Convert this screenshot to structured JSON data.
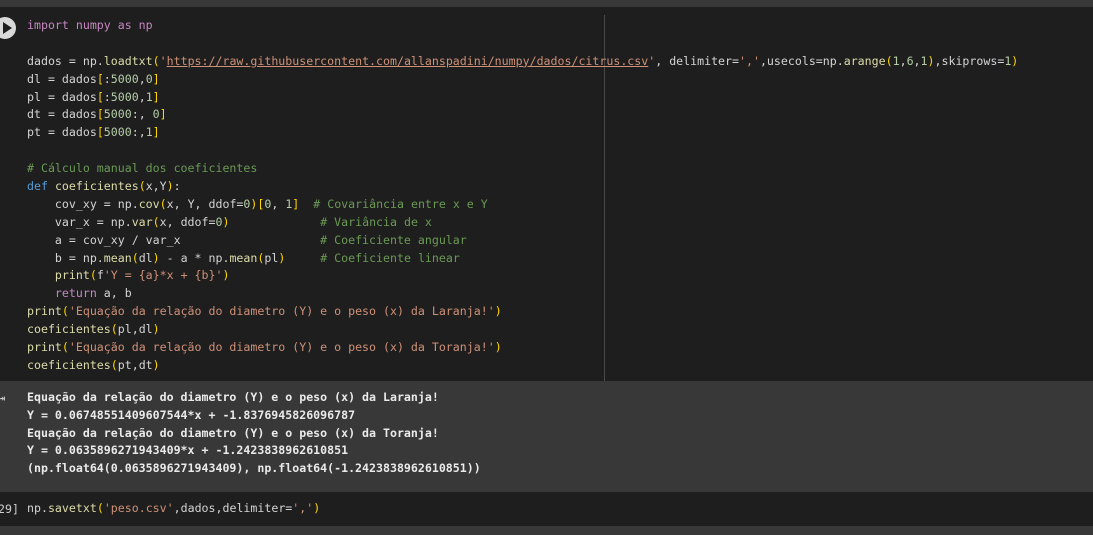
{
  "cell1": {
    "lines": [
      "import numpy as np",
      "",
      "dados = np.loadtxt('https://raw.githubusercontent.com/allanspadini/numpy/dados/citrus.csv', delimiter=',',usecols=np.arange(1,6,1),skiprows=1)",
      "dl = dados[:5000,0]",
      "pl = dados[:5000,1]",
      "dt = dados[5000:, 0]",
      "pt = dados[5000:,1]",
      "",
      "# Cálculo manual dos coeficientes",
      "def coeficientes(x,Y):",
      "    cov_xy = np.cov(x, Y, ddof=0)[0, 1]  # Covariância entre x e Y",
      "    var_x = np.var(x, ddof=0)             # Variância de x",
      "    a = cov_xy / var_x                    # Coeficiente angular",
      "    b = np.mean(dl) - a * np.mean(pl)     # Coeficiente linear",
      "    print(f'Y = {a}*x + {b}')",
      "    return a, b",
      "print('Equação da relação do diametro (Y) e o peso (x) da Laranja!')",
      "coeficientes(pl,dl)",
      "print('Equação da relação do diametro (Y) e o peso (x) da Toranja!')",
      "coeficientes(pt,dt)"
    ]
  },
  "output": {
    "lines": [
      "Equação da relação do diametro (Y) e o peso (x) da Laranja!",
      "Y = 0.06748551409607544*x + -1.8376945826096787",
      "Equação da relação do diametro (Y) e o peso (x) da Toranja!",
      "Y = 0.0635896271943409*x + -1.2423838962610851",
      "(np.float64(0.0635896271943409), np.float64(-1.2423838962610851))"
    ]
  },
  "cell2": {
    "exec_count": "29]",
    "code": "np.savetxt('peso.csv',dados,delimiter=',')"
  },
  "icons": {
    "run": "run-cell-icon",
    "output": "output-toggle-icon"
  }
}
